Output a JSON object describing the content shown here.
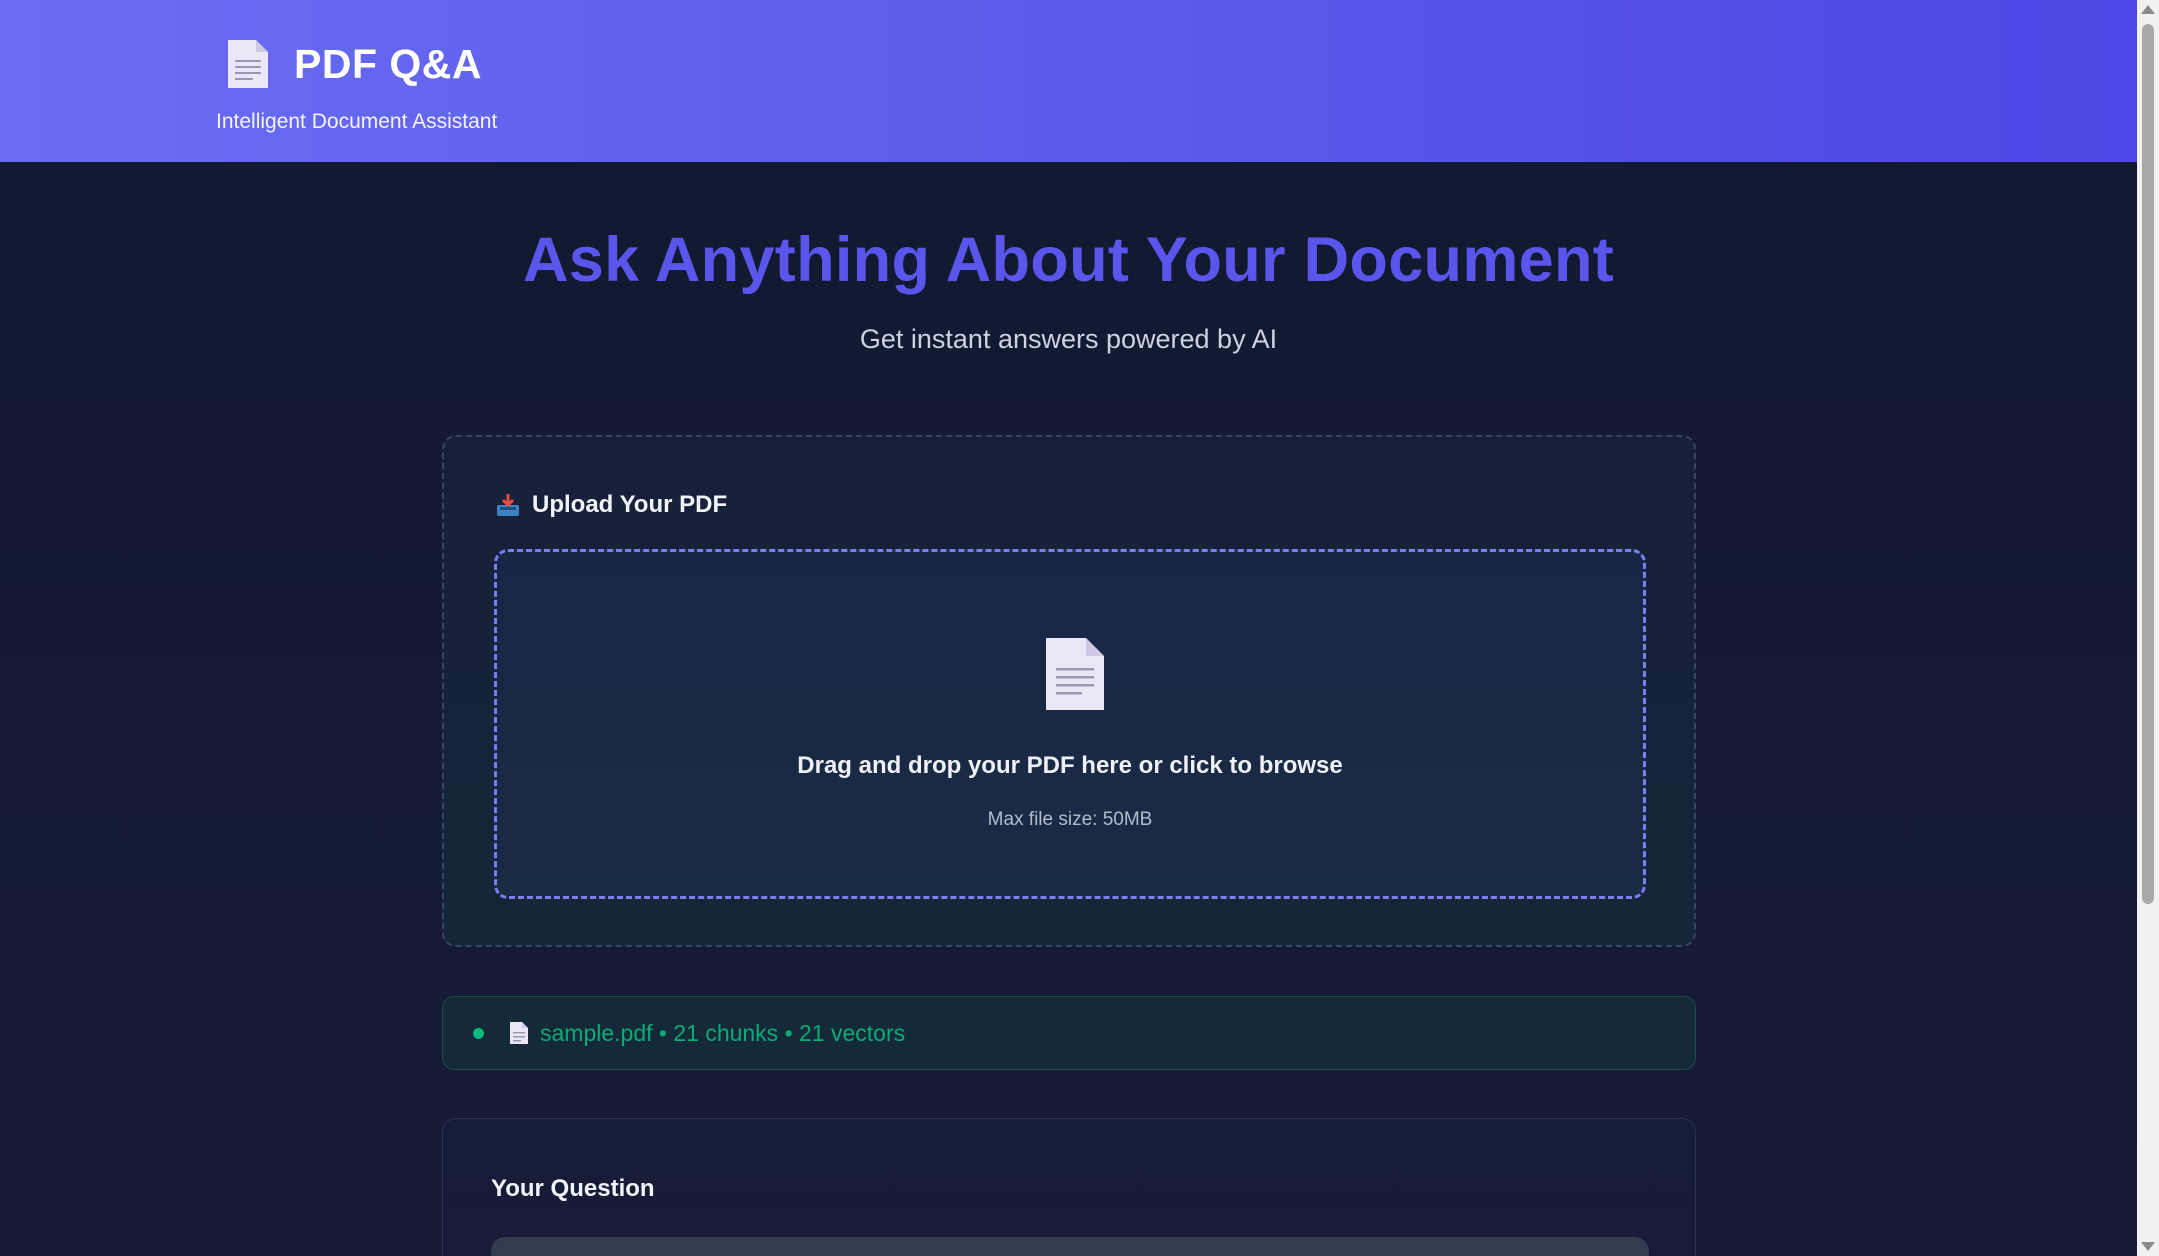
{
  "header": {
    "title": "PDF Q&A",
    "subtitle": "Intelligent Document Assistant",
    "logo_icon": "document-icon"
  },
  "hero": {
    "title": "Ask Anything About Your Document",
    "subtitle": "Get instant answers powered by AI"
  },
  "upload": {
    "heading": "Upload Your PDF",
    "heading_icon": "inbox-tray-icon",
    "dropzone_text": "Drag and drop your PDF here or click to browse",
    "dropzone_hint": "Max file size: 50MB",
    "dropzone_icon": "document-icon"
  },
  "status": {
    "text": "sample.pdf • 21 chunks • 21 vectors",
    "color": "#10b981"
  },
  "question": {
    "heading": "Your Question",
    "placeholder": ""
  },
  "colors": {
    "accent": "#4f46e5",
    "header_gradient_start": "#6a6cf3",
    "success": "#10b981",
    "background": "#131a30"
  }
}
